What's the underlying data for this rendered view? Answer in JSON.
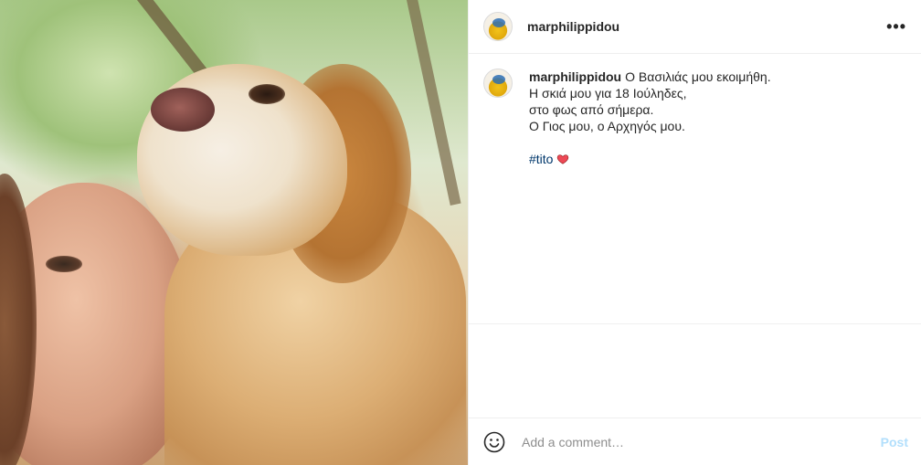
{
  "post": {
    "photo_alt": "",
    "author": {
      "username": "marphilippidou"
    },
    "caption": {
      "username": "marphilippidou",
      "lines": [
        "Ο Βασιλιάς μου εκοιμήθη.",
        "Η σκιά μου για 18 Ιούληδες,",
        "στο φως από σήμερα.",
        "Ο Γιος μου, ο Αρχηγός μου."
      ],
      "hashtag": "#tito",
      "emoji_icon": "red-heart-icon"
    },
    "more_icon": "more-options-icon",
    "more_label": "•••"
  },
  "comment_bar": {
    "emoji_icon": "smiley-icon",
    "placeholder": "Add a comment…",
    "post_label": "Post"
  },
  "colors": {
    "border": "#efefef",
    "text": "#262626",
    "hashtag": "#00376b",
    "post_button_disabled": "#b2dffc",
    "heart": "#ed4956"
  }
}
